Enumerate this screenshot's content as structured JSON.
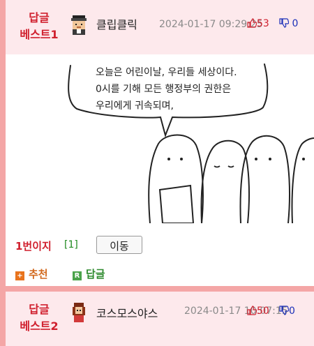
{
  "comment1": {
    "best_line1": "답글",
    "best_line2": "베스트1",
    "nickname": "클립클릭",
    "date": "2024-01-17 09:29:25",
    "upvotes": "53",
    "downvotes": "0",
    "comic_lines": [
      "오늘은 어린이날, 우리들 세상이다.",
      "0시를 기해 모든 행정부의 권한은",
      "우리에게 귀속되며,"
    ],
    "page_label": "1번이지",
    "page_number": "[1]",
    "move_button": "이동",
    "recommend_label": "추천",
    "recommend_icon": "+",
    "reply_label": "답글",
    "reply_icon": "R"
  },
  "comment2": {
    "best_line1": "답글",
    "best_line2": "베스트2",
    "nickname": "코스모스야스",
    "date": "2024-01-17 10:07:15",
    "upvotes": "50",
    "downvotes": "0"
  },
  "colors": {
    "page_border": "#f4a6a6",
    "header_bg": "#fde9ec",
    "best_red": "#d0202e",
    "down_blue": "#1a2fb8",
    "recommend_orange": "#e8731d",
    "reply_green": "#4aa34a"
  }
}
